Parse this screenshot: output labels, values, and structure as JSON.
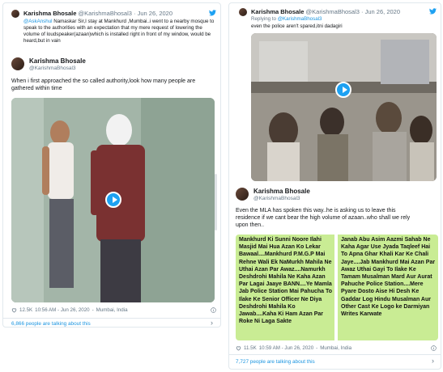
{
  "left_tweet": {
    "reply": {
      "name": "Karishma Bhosale",
      "handle": "@KarishmaBhosal3",
      "date": "· Jun 26, 2020",
      "mention": "@AskAnshul",
      "text": " Namaskar Sir,I stay at Mankhurd ,Mumbai..i went to a nearby mosque to speak to the authorities with an expectation that my mere request of lowering the  volume of loudspeaker(azaan)which is installed right in front of my window, would be heard,but in vain"
    },
    "main": {
      "name": "Karishma Bhosale",
      "handle": "@KarishmaBhosal3",
      "text": "When i first approached the so called authority,look how many people are gathered within time"
    },
    "likes": "12.5K",
    "time": "10:56 AM - Jun 26, 2020",
    "location": "Mumbai, India",
    "talking": "6,866 people are talking about this"
  },
  "right_tweet": {
    "reply": {
      "name": "Karishma Bhosale",
      "handle": "@KarishmaBhosal3",
      "date": "· Jun 26, 2020",
      "replying_prefix": "Replying to ",
      "replying_handle": "@KarishmaBhosal3",
      "text": "even the police aren't spared,itni dadagiri"
    },
    "main": {
      "name": "Karishma Bhosale",
      "handle": "@KarishmaBhosal3",
      "text": "Even the MLA has spoken this way..he is asking us to leave this residence if we cant bear the high volume of azaan..who shall we rely upon then.."
    },
    "letter_left": "Mankhurd Ki Sunni Noore Ilahi Masjid Mai Hua Azan Ko Lekar Bawaal....Mankhurd P.M.G.P Mai Rehne Wali Ek NaMurkh Mahila Ne Uthai Azan Par Awaz....Namurkh Deshdrohi Mahila Ne Kaha Azan Par Lagai Jaaye BANN....Ye Mamla Jab Police Station Mai Pahucha To Ilake Ke Senior Officer Ne Diya Deshdrohi Mahila Ko Jawab....Kaha Ki Ham Azan Par Roke Ni Laga Sakte",
    "letter_right": "Janab Abu Asim Aazmi Sahab Ne Kaha Agar Use Jyada Taqleef Hai To Apna Ghar Khali Kar Ke Chali Jaye....Jab Mankhurd Mai Azan Par Awaz Uthai Gayi To Ilake Ke Tamam Musalman Mard Aur Aurat Pahuche Police Station....Mere Pyare Dosto Aise Hi Desh Ke Gaddar Log Hindu Musalman Aur Other Cast Ke Logo ke Darmiyan Writes Karwate",
    "likes": "11.5K",
    "time": "10:59 AM - Jun 26, 2020",
    "location": "Mumbai, India",
    "talking": "7,727 people are talking about this"
  },
  "colors": {
    "accent": "#1da1f2",
    "link": "#1b95e0",
    "muted": "#657786",
    "letter_bg": "#c9ec94"
  },
  "icons": [
    "twitter-bird-icon",
    "heart-icon",
    "info-icon",
    "chevron-right-icon",
    "play-icon",
    "verified-icon"
  ]
}
